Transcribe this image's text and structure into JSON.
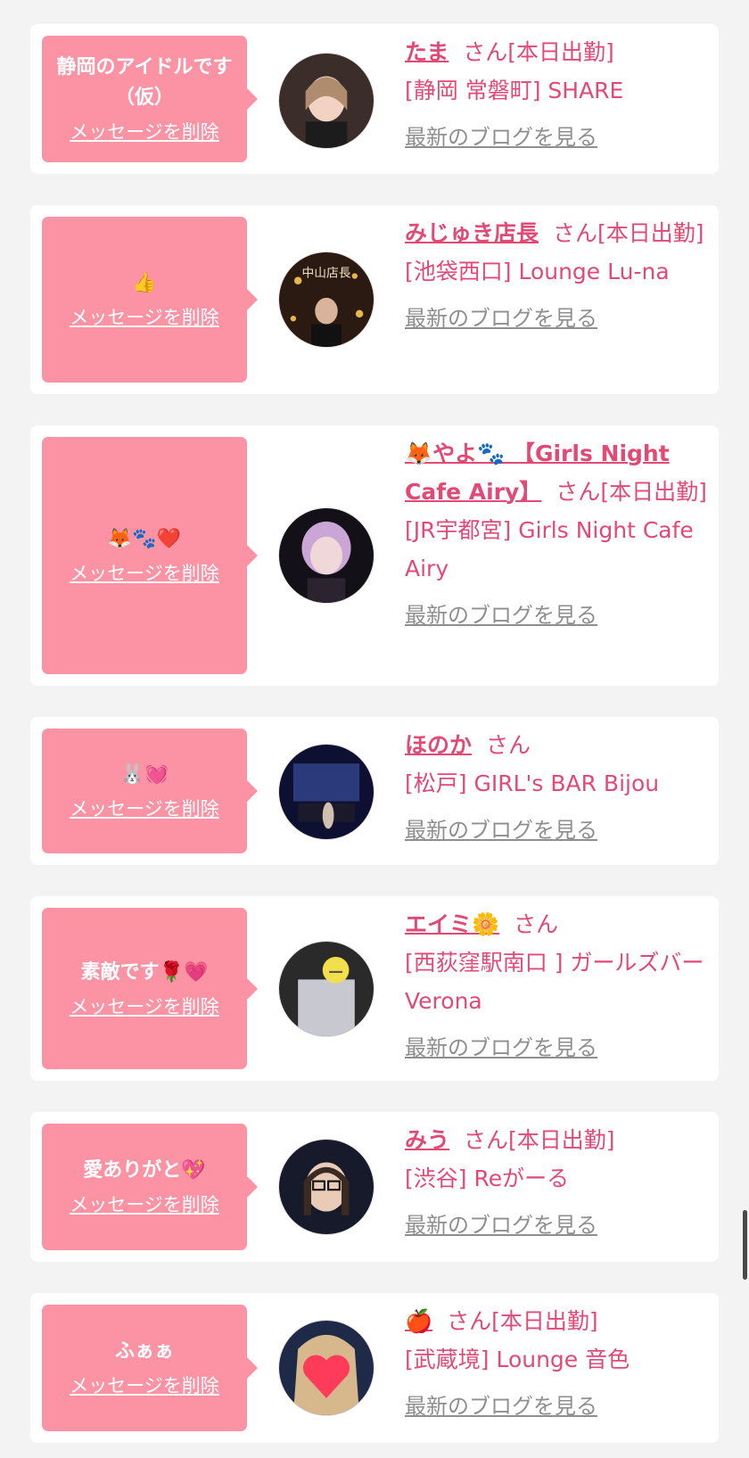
{
  "delete_label": "メッセージを削除",
  "blog_label": "最新のブログを見る",
  "san_suffix": "さん",
  "items": [
    {
      "message": "静岡のアイドルです（仮）",
      "name": "たま",
      "status": "[本日出勤]",
      "shop": "[静岡 常磐町] SHARE"
    },
    {
      "message": "👍",
      "name": "みじゅき店長",
      "status": "[本日出勤]",
      "shop": "[池袋西口] Lounge Lu-na",
      "avatar_text": "中山店長"
    },
    {
      "message": "🦊🐾❤️",
      "name": "🦊やよ🐾 【Girls Night Cafe Airy】",
      "status": "[本日出勤]",
      "shop": "[JR宇都宮] Girls Night Cafe Airy"
    },
    {
      "message": "🐰💓",
      "name": "ほのか",
      "status": "",
      "shop": "[松戸] GIRL's BAR Bijou"
    },
    {
      "message": "素敵です🌹💗",
      "name": "エイミ🌼",
      "status": "",
      "shop": "[西荻窪駅南口 ] ガールズバー Verona"
    },
    {
      "message": "愛ありがと💖",
      "name": "みう",
      "status": "[本日出勤]",
      "shop": "[渋谷] Reがーる"
    },
    {
      "message": "ふぁぁ",
      "name": "🍎",
      "status": "[本日出勤]",
      "shop": "[武蔵境] Lounge 音色"
    }
  ]
}
